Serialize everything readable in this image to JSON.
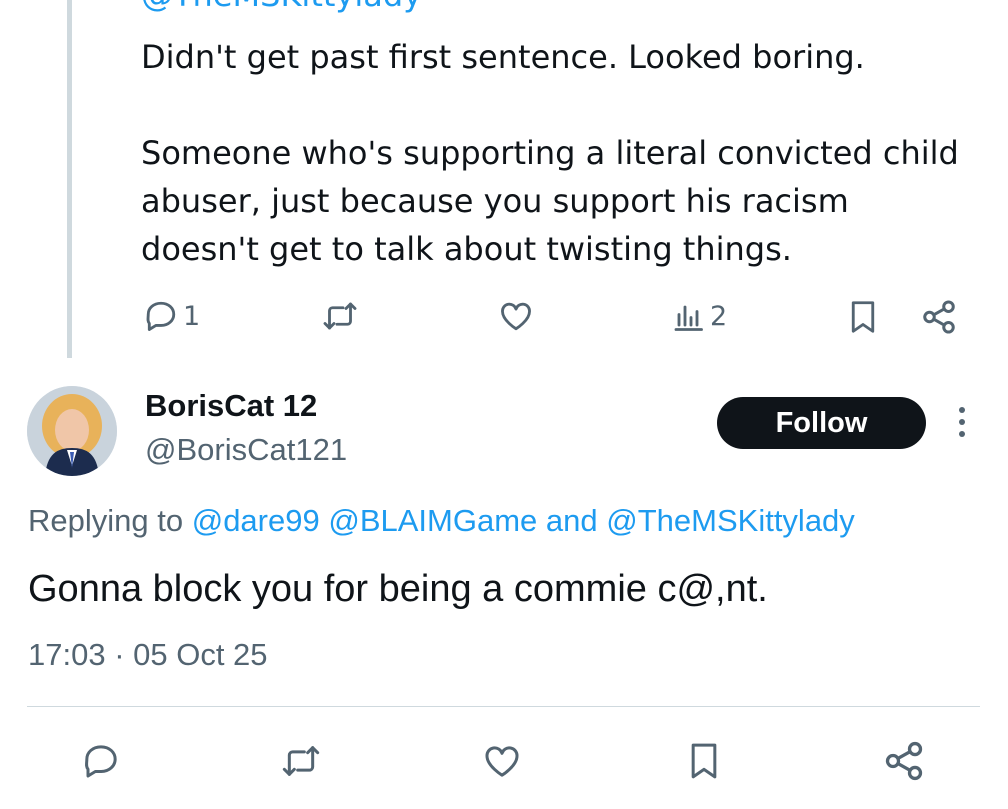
{
  "previous_tweet": {
    "mention_partial": "@TheMSKittylady",
    "lines": [
      "Didn't get past first sentence. Looked boring.",
      "",
      "Someone who's supporting a literal convicted child",
      "abuser, just because you support his racism",
      "doesn't get to talk about twisting things."
    ],
    "stats": {
      "replies": "1",
      "views": "2"
    }
  },
  "tweet": {
    "display_name": "BorisCat 12",
    "handle": "@BorisCat121",
    "follow_label": "Follow",
    "replying_prefix": "Replying to",
    "replying_to": [
      "@dare99",
      "@BLAIMGame"
    ],
    "replying_and": "and",
    "replying_last": "@TheMSKittylady",
    "text": "Gonna block you for being a commie c@,nt.",
    "timestamp": "17:03 · 05 Oct 25"
  },
  "icons": [
    "reply-icon",
    "retweet-icon",
    "like-icon",
    "views-icon",
    "bookmark-icon",
    "share-icon",
    "more-icon"
  ],
  "colors": {
    "accent": "#1d9bf0",
    "text": "#0f1419",
    "muted": "#536471",
    "divider": "#cfd9de",
    "button": "#0f1419"
  }
}
